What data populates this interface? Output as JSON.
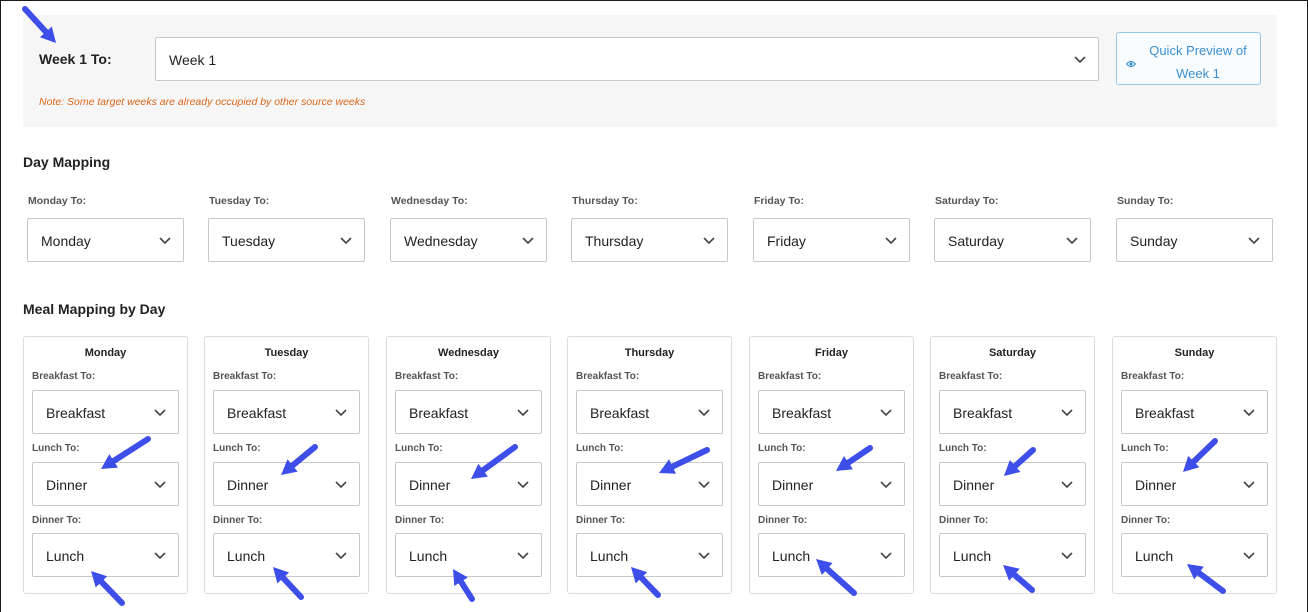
{
  "week": {
    "label": "Week 1 To:",
    "selected": "Week 1",
    "note": "Note: Some target weeks are already occupied by other source weeks",
    "preview_button": "Quick Preview of Week 1"
  },
  "day_mapping": {
    "title": "Day Mapping",
    "days": [
      {
        "label": "Monday To:",
        "value": "Monday"
      },
      {
        "label": "Tuesday To:",
        "value": "Tuesday"
      },
      {
        "label": "Wednesday To:",
        "value": "Wednesday"
      },
      {
        "label": "Thursday To:",
        "value": "Thursday"
      },
      {
        "label": "Friday To:",
        "value": "Friday"
      },
      {
        "label": "Saturday To:",
        "value": "Saturday"
      },
      {
        "label": "Sunday To:",
        "value": "Sunday"
      }
    ]
  },
  "meal_mapping": {
    "title": "Meal Mapping by Day",
    "cards": [
      {
        "day": "Monday",
        "breakfast_label": "Breakfast To:",
        "breakfast": "Breakfast",
        "lunch_label": "Lunch To:",
        "lunch": "Dinner",
        "dinner_label": "Dinner To:",
        "dinner": "Lunch"
      },
      {
        "day": "Tuesday",
        "breakfast_label": "Breakfast To:",
        "breakfast": "Breakfast",
        "lunch_label": "Lunch To:",
        "lunch": "Dinner",
        "dinner_label": "Dinner To:",
        "dinner": "Lunch"
      },
      {
        "day": "Wednesday",
        "breakfast_label": "Breakfast To:",
        "breakfast": "Breakfast",
        "lunch_label": "Lunch To:",
        "lunch": "Dinner",
        "dinner_label": "Dinner To:",
        "dinner": "Lunch"
      },
      {
        "day": "Thursday",
        "breakfast_label": "Breakfast To:",
        "breakfast": "Breakfast",
        "lunch_label": "Lunch To:",
        "lunch": "Dinner",
        "dinner_label": "Dinner To:",
        "dinner": "Lunch"
      },
      {
        "day": "Friday",
        "breakfast_label": "Breakfast To:",
        "breakfast": "Breakfast",
        "lunch_label": "Lunch To:",
        "lunch": "Dinner",
        "dinner_label": "Dinner To:",
        "dinner": "Lunch"
      },
      {
        "day": "Saturday",
        "breakfast_label": "Breakfast To:",
        "breakfast": "Breakfast",
        "lunch_label": "Lunch To:",
        "lunch": "Dinner",
        "dinner_label": "Dinner To:",
        "dinner": "Lunch"
      },
      {
        "day": "Sunday",
        "breakfast_label": "Breakfast To:",
        "breakfast": "Breakfast",
        "lunch_label": "Lunch To:",
        "lunch": "Dinner",
        "dinner_label": "Dinner To:",
        "dinner": "Lunch"
      }
    ]
  },
  "icons": {
    "dropdown": "chevron-down-icon",
    "preview": "eye-icon",
    "annotation": "annotation-arrow-icon"
  },
  "colors": {
    "note": "#d9661a",
    "preview_accent": "#3a8fd0",
    "annotation_arrow": "#3d4fe8"
  }
}
